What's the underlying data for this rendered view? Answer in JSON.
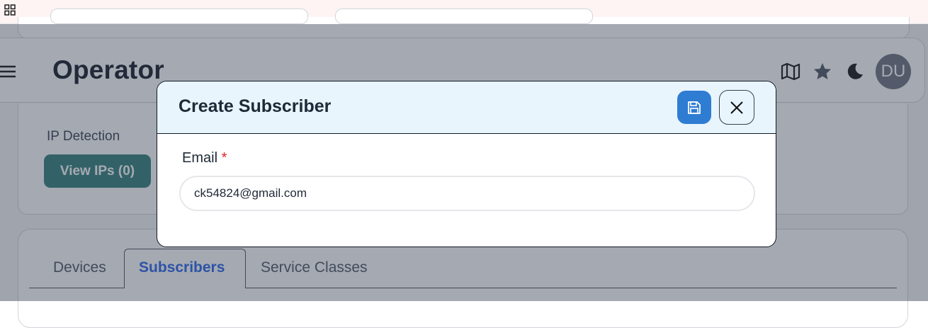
{
  "topbar": {
    "apps_icon": "grid-icon"
  },
  "header": {
    "title": "Operator",
    "menu_icon": "hamburger-menu-icon",
    "icons": [
      "map-icon",
      "star-icon",
      "moon-icon"
    ],
    "avatar_initials": "DU"
  },
  "ip_section": {
    "label": "IP Detection",
    "view_button": "View IPs (0)"
  },
  "tabs": [
    {
      "label": "Devices",
      "active": false
    },
    {
      "label": "Subscribers",
      "active": true
    },
    {
      "label": "Service Classes",
      "active": false
    }
  ],
  "modal": {
    "title": "Create Subscriber",
    "save_icon": "save-icon",
    "close_icon": "close-icon",
    "email_label": "Email",
    "required_mark": "*",
    "email_value": "ck54824@gmail.com"
  },
  "colors": {
    "accent": "#2f7cd3",
    "teal_button": "#2f7f7a",
    "modal_header_bg": "#e8f5fc",
    "active_tab": "#2563eb"
  }
}
